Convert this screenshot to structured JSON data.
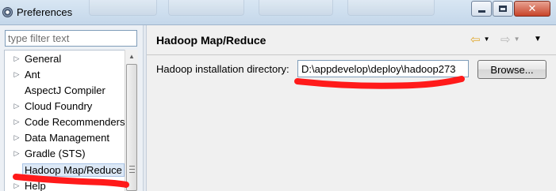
{
  "window": {
    "title": "Preferences"
  },
  "filter": {
    "placeholder": "type filter text"
  },
  "tree": {
    "items": [
      {
        "label": "General",
        "expandable": true
      },
      {
        "label": "Ant",
        "expandable": true
      },
      {
        "label": "AspectJ Compiler",
        "expandable": false
      },
      {
        "label": "Cloud Foundry",
        "expandable": true
      },
      {
        "label": "Code Recommenders",
        "expandable": true
      },
      {
        "label": "Data Management",
        "expandable": true
      },
      {
        "label": "Gradle (STS)",
        "expandable": true
      },
      {
        "label": "Hadoop Map/Reduce",
        "expandable": false,
        "selected": true
      },
      {
        "label": "Help",
        "expandable": true
      }
    ]
  },
  "page": {
    "title": "Hadoop Map/Reduce",
    "field_label": "Hadoop installation directory:",
    "field_value": "D:\\appdevelop\\deploy\\hadoop273",
    "browse_label": "Browse..."
  },
  "colors": {
    "annotation": "#ff1a1a",
    "nav_back": "#e0a82e",
    "nav_forward": "#b8b8b8"
  },
  "icons": {
    "app": "eclipse-icon",
    "nav_back": "back-arrow-icon",
    "nav_forward": "forward-arrow-icon",
    "view_menu": "view-menu-icon",
    "expand": "expand-arrow-icon"
  }
}
